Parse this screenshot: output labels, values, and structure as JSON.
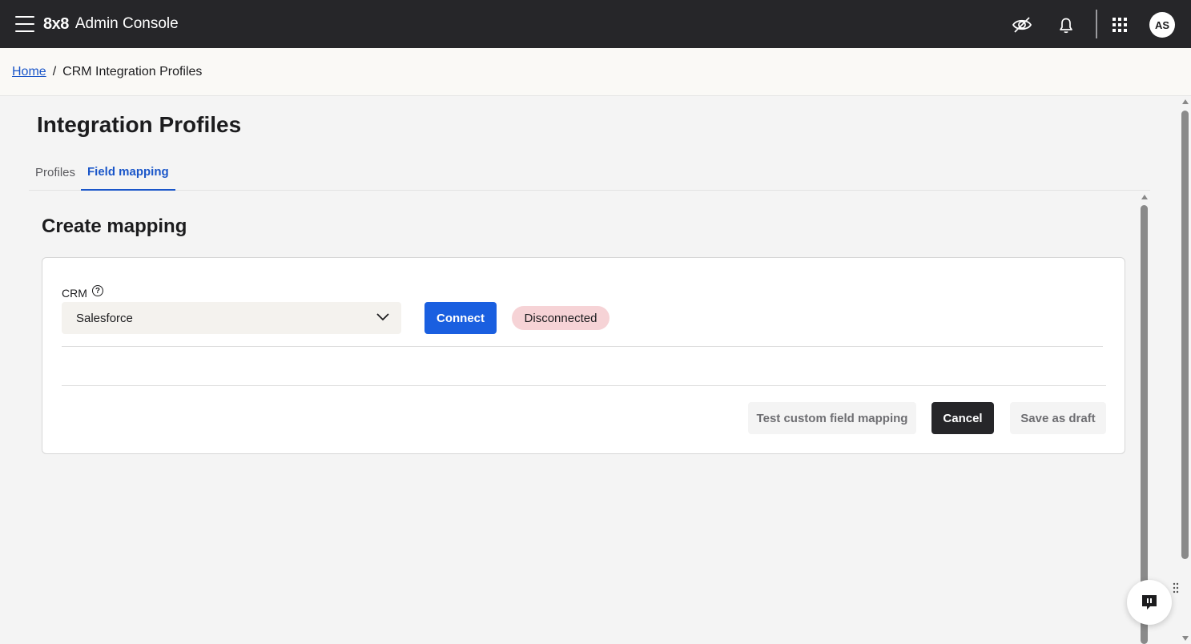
{
  "header": {
    "brand_logo": "8x8",
    "brand_title": "Admin Console",
    "avatar_initials": "AS"
  },
  "breadcrumb": {
    "home": "Home",
    "separator": "/",
    "current": "CRM Integration Profiles"
  },
  "page": {
    "title": "Integration Profiles",
    "tabs": [
      {
        "label": "Profiles",
        "active": false
      },
      {
        "label": "Field mapping",
        "active": true
      }
    ]
  },
  "mapping": {
    "section_title": "Create mapping",
    "crm_label": "CRM",
    "help_glyph": "?",
    "crm_selected": "Salesforce",
    "connect_label": "Connect",
    "status_label": "Disconnected",
    "status_color": "#f6d3d6",
    "actions": {
      "test_label": "Test custom field mapping",
      "cancel_label": "Cancel",
      "draft_label": "Save as draft"
    }
  },
  "colors": {
    "topbar": "#262629",
    "accent": "#1a5fe0",
    "link": "#1a56c9"
  },
  "icons": [
    "hamburger-icon",
    "eye-off-icon",
    "bell-icon",
    "apps-grid-icon",
    "chevron-down-icon",
    "help-circle-icon",
    "chat-icon"
  ]
}
